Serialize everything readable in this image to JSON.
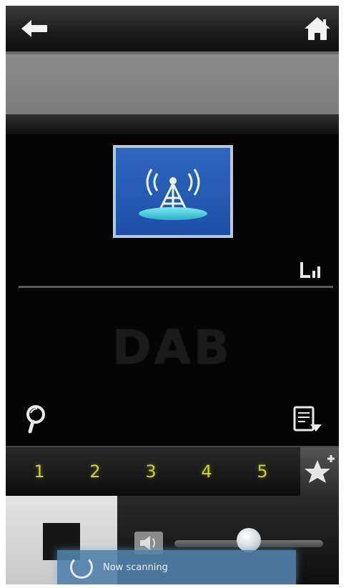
{
  "header": {
    "back_icon": "back-arrow-icon",
    "home_icon": "home-icon"
  },
  "station": {
    "name": ""
  },
  "display": {
    "mode_label": "DAB",
    "art_icon": "radio-tower-icon",
    "signal_icon": "signal-strength-icon"
  },
  "actions": {
    "search_icon": "search-icon",
    "info_icon": "station-info-icon"
  },
  "presets": [
    {
      "label": "1"
    },
    {
      "label": "2"
    },
    {
      "label": "3"
    },
    {
      "label": "4"
    },
    {
      "label": "5"
    }
  ],
  "favorites_icon": "star-add-icon",
  "controls": {
    "stop_icon": "stop-icon",
    "mute_icon": "speaker-icon",
    "volume_level": 0.5
  },
  "toast": {
    "text": "Now scanning"
  },
  "colors": {
    "accent": "#c8d23a",
    "tile": "#2f66c0",
    "toast": "#5082aa"
  }
}
